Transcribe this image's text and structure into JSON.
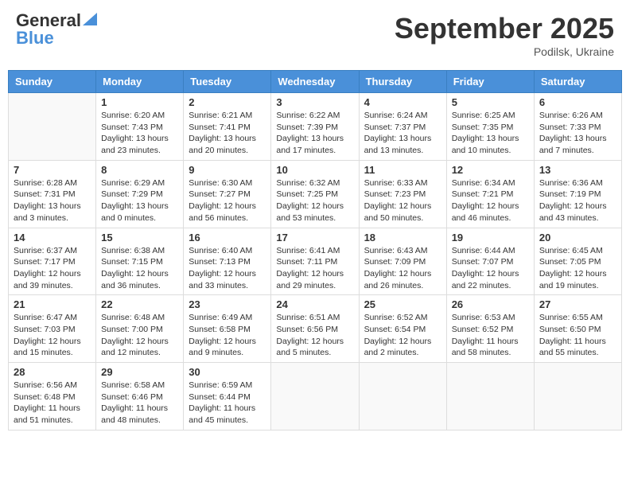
{
  "logo": {
    "general": "General",
    "blue": "Blue"
  },
  "title": "September 2025",
  "location": "Podilsk, Ukraine",
  "days_of_week": [
    "Sunday",
    "Monday",
    "Tuesday",
    "Wednesday",
    "Thursday",
    "Friday",
    "Saturday"
  ],
  "weeks": [
    [
      {
        "day": "",
        "sunrise": "",
        "sunset": "",
        "daylight": ""
      },
      {
        "day": "1",
        "sunrise": "Sunrise: 6:20 AM",
        "sunset": "Sunset: 7:43 PM",
        "daylight": "Daylight: 13 hours and 23 minutes."
      },
      {
        "day": "2",
        "sunrise": "Sunrise: 6:21 AM",
        "sunset": "Sunset: 7:41 PM",
        "daylight": "Daylight: 13 hours and 20 minutes."
      },
      {
        "day": "3",
        "sunrise": "Sunrise: 6:22 AM",
        "sunset": "Sunset: 7:39 PM",
        "daylight": "Daylight: 13 hours and 17 minutes."
      },
      {
        "day": "4",
        "sunrise": "Sunrise: 6:24 AM",
        "sunset": "Sunset: 7:37 PM",
        "daylight": "Daylight: 13 hours and 13 minutes."
      },
      {
        "day": "5",
        "sunrise": "Sunrise: 6:25 AM",
        "sunset": "Sunset: 7:35 PM",
        "daylight": "Daylight: 13 hours and 10 minutes."
      },
      {
        "day": "6",
        "sunrise": "Sunrise: 6:26 AM",
        "sunset": "Sunset: 7:33 PM",
        "daylight": "Daylight: 13 hours and 7 minutes."
      }
    ],
    [
      {
        "day": "7",
        "sunrise": "Sunrise: 6:28 AM",
        "sunset": "Sunset: 7:31 PM",
        "daylight": "Daylight: 13 hours and 3 minutes."
      },
      {
        "day": "8",
        "sunrise": "Sunrise: 6:29 AM",
        "sunset": "Sunset: 7:29 PM",
        "daylight": "Daylight: 13 hours and 0 minutes."
      },
      {
        "day": "9",
        "sunrise": "Sunrise: 6:30 AM",
        "sunset": "Sunset: 7:27 PM",
        "daylight": "Daylight: 12 hours and 56 minutes."
      },
      {
        "day": "10",
        "sunrise": "Sunrise: 6:32 AM",
        "sunset": "Sunset: 7:25 PM",
        "daylight": "Daylight: 12 hours and 53 minutes."
      },
      {
        "day": "11",
        "sunrise": "Sunrise: 6:33 AM",
        "sunset": "Sunset: 7:23 PM",
        "daylight": "Daylight: 12 hours and 50 minutes."
      },
      {
        "day": "12",
        "sunrise": "Sunrise: 6:34 AM",
        "sunset": "Sunset: 7:21 PM",
        "daylight": "Daylight: 12 hours and 46 minutes."
      },
      {
        "day": "13",
        "sunrise": "Sunrise: 6:36 AM",
        "sunset": "Sunset: 7:19 PM",
        "daylight": "Daylight: 12 hours and 43 minutes."
      }
    ],
    [
      {
        "day": "14",
        "sunrise": "Sunrise: 6:37 AM",
        "sunset": "Sunset: 7:17 PM",
        "daylight": "Daylight: 12 hours and 39 minutes."
      },
      {
        "day": "15",
        "sunrise": "Sunrise: 6:38 AM",
        "sunset": "Sunset: 7:15 PM",
        "daylight": "Daylight: 12 hours and 36 minutes."
      },
      {
        "day": "16",
        "sunrise": "Sunrise: 6:40 AM",
        "sunset": "Sunset: 7:13 PM",
        "daylight": "Daylight: 12 hours and 33 minutes."
      },
      {
        "day": "17",
        "sunrise": "Sunrise: 6:41 AM",
        "sunset": "Sunset: 7:11 PM",
        "daylight": "Daylight: 12 hours and 29 minutes."
      },
      {
        "day": "18",
        "sunrise": "Sunrise: 6:43 AM",
        "sunset": "Sunset: 7:09 PM",
        "daylight": "Daylight: 12 hours and 26 minutes."
      },
      {
        "day": "19",
        "sunrise": "Sunrise: 6:44 AM",
        "sunset": "Sunset: 7:07 PM",
        "daylight": "Daylight: 12 hours and 22 minutes."
      },
      {
        "day": "20",
        "sunrise": "Sunrise: 6:45 AM",
        "sunset": "Sunset: 7:05 PM",
        "daylight": "Daylight: 12 hours and 19 minutes."
      }
    ],
    [
      {
        "day": "21",
        "sunrise": "Sunrise: 6:47 AM",
        "sunset": "Sunset: 7:03 PM",
        "daylight": "Daylight: 12 hours and 15 minutes."
      },
      {
        "day": "22",
        "sunrise": "Sunrise: 6:48 AM",
        "sunset": "Sunset: 7:00 PM",
        "daylight": "Daylight: 12 hours and 12 minutes."
      },
      {
        "day": "23",
        "sunrise": "Sunrise: 6:49 AM",
        "sunset": "Sunset: 6:58 PM",
        "daylight": "Daylight: 12 hours and 9 minutes."
      },
      {
        "day": "24",
        "sunrise": "Sunrise: 6:51 AM",
        "sunset": "Sunset: 6:56 PM",
        "daylight": "Daylight: 12 hours and 5 minutes."
      },
      {
        "day": "25",
        "sunrise": "Sunrise: 6:52 AM",
        "sunset": "Sunset: 6:54 PM",
        "daylight": "Daylight: 12 hours and 2 minutes."
      },
      {
        "day": "26",
        "sunrise": "Sunrise: 6:53 AM",
        "sunset": "Sunset: 6:52 PM",
        "daylight": "Daylight: 11 hours and 58 minutes."
      },
      {
        "day": "27",
        "sunrise": "Sunrise: 6:55 AM",
        "sunset": "Sunset: 6:50 PM",
        "daylight": "Daylight: 11 hours and 55 minutes."
      }
    ],
    [
      {
        "day": "28",
        "sunrise": "Sunrise: 6:56 AM",
        "sunset": "Sunset: 6:48 PM",
        "daylight": "Daylight: 11 hours and 51 minutes."
      },
      {
        "day": "29",
        "sunrise": "Sunrise: 6:58 AM",
        "sunset": "Sunset: 6:46 PM",
        "daylight": "Daylight: 11 hours and 48 minutes."
      },
      {
        "day": "30",
        "sunrise": "Sunrise: 6:59 AM",
        "sunset": "Sunset: 6:44 PM",
        "daylight": "Daylight: 11 hours and 45 minutes."
      },
      {
        "day": "",
        "sunrise": "",
        "sunset": "",
        "daylight": ""
      },
      {
        "day": "",
        "sunrise": "",
        "sunset": "",
        "daylight": ""
      },
      {
        "day": "",
        "sunrise": "",
        "sunset": "",
        "daylight": ""
      },
      {
        "day": "",
        "sunrise": "",
        "sunset": "",
        "daylight": ""
      }
    ]
  ]
}
